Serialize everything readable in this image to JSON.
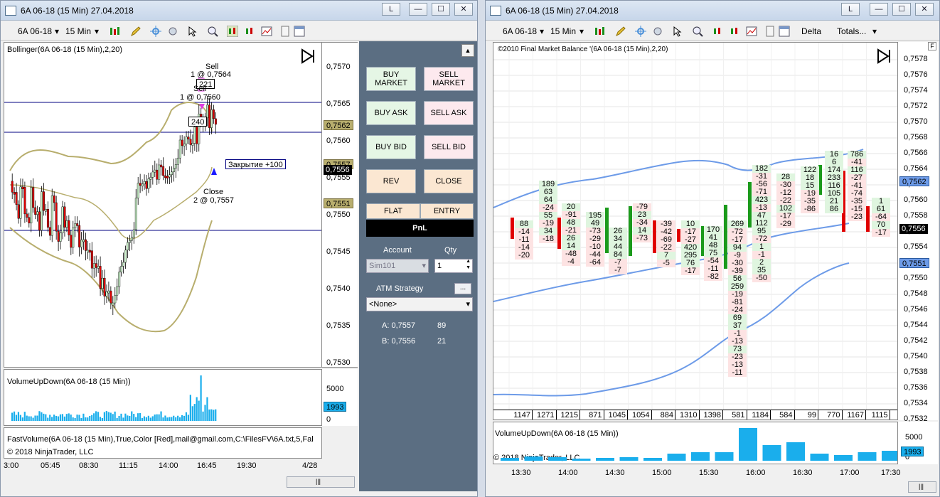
{
  "left_window": {
    "title": "6A 06-18 (15 Min)  27.04.2018",
    "toolbar": {
      "instrument": "6A 06-18",
      "timeframe": "15 Min"
    },
    "buttons": {
      "l": "L",
      "min": "—",
      "max": "☐",
      "close": "✕"
    },
    "indicator_top": "Bollinger(6A 06-18 (15 Min),2,20)",
    "indicator_vol": "VolumeUpDown(6A 06-18 (15 Min))",
    "fastvolume": "FastVolume(6A 06-18 (15 Min),True,Color [Red],mail@gmail.com,C:\\FilesFV\\6A.txt,5,Fal",
    "copyright": "© 2018 NinjaTrader, LLC",
    "price_axis": [
      "0,7570",
      "0,7565",
      "0,7560",
      "0,7555",
      "0,7550",
      "0,7545",
      "0,7540",
      "0,7535",
      "0,7530"
    ],
    "price_badges": {
      "b1": "0,7562",
      "b2": "0,7557",
      "b3": "0,7556",
      "b4": "0,7551"
    },
    "vol_axis": [
      "5000",
      "0"
    ],
    "vol_badge": "1993",
    "time_axis": [
      "3:00",
      "05:45",
      "08:30",
      "11:15",
      "14:00",
      "16:45",
      "19:30",
      "4/28"
    ],
    "annotations": {
      "sell1": "Sell",
      "sell1b": "1 @ 0,7564",
      "sell2": "Sell",
      "sell2b": "1 @ 0,7560",
      "q221": "221",
      "q240": "240",
      "close": "Close",
      "closeb": "2 @ 0,7557",
      "closing": "Закрытие +100"
    }
  },
  "order_panel": {
    "buy_market": "BUY MARKET",
    "sell_market": "SELL MARKET",
    "buy_ask": "BUY ASK",
    "sell_ask": "SELL ASK",
    "buy_bid": "BUY BID",
    "sell_bid": "SELL BID",
    "rev": "REV",
    "close": "CLOSE",
    "flat": "FLAT",
    "entry": "ENTRY",
    "pnl": "PnL",
    "account_label": "Account",
    "qty_label": "Qty",
    "account_value": "Sim101",
    "qty_value": "1",
    "atm_label": "ATM Strategy",
    "atm_btn": "...",
    "atm_value": "<None>",
    "ask_label": "A: 0,7557",
    "ask_size": "89",
    "bid_label": "B: 0,7556",
    "bid_size": "21"
  },
  "right_window": {
    "title": "6A 06-18 (15 Min)  27.04.2018",
    "toolbar": {
      "instrument": "6A 06-18",
      "timeframe": "15 Min",
      "delta": "Delta",
      "totals": "Totals..."
    },
    "buttons": {
      "l": "L",
      "min": "—",
      "max": "☐",
      "close": "✕"
    },
    "indicator_top": "©2010 Final Market Balance  '(6A 06-18 (15 Min),2,20)",
    "indicator_vol": "VolumeUpDown(6A 06-18 (15 Min))",
    "copyright": "© 2018 NinjaTrader, LLC",
    "f_label": "F",
    "price_axis": [
      "0,7578",
      "0,7576",
      "0,7574",
      "0,7572",
      "0,7570",
      "0,7568",
      "0,7566",
      "0,7564",
      "0,7562",
      "0,7560",
      "0,7558",
      "0,7556",
      "0,7554",
      "0,7552",
      "0,7550",
      "0,7548",
      "0,7546",
      "0,7544",
      "0,7542",
      "0,7540",
      "0,7538",
      "0,7536",
      "0,7534",
      "0,7532"
    ],
    "price_badges": {
      "b1": "0,7562",
      "b2": "0,7556",
      "b3": "0,7551"
    },
    "vol_axis": [
      "5000",
      "0"
    ],
    "vol_badge": "1993",
    "time_axis": [
      "13:30",
      "14:00",
      "14:30",
      "15:00",
      "15:30",
      "16:00",
      "16:30",
      "17:00",
      "17:30"
    ],
    "totals_row": [
      "1147",
      "1271",
      "1215",
      "871",
      "1045",
      "1054",
      "884",
      "1310",
      "1398",
      "581",
      "1184",
      "584",
      "99",
      "770",
      "1167",
      "1115"
    ]
  },
  "colors": {
    "bull": "#00aa00",
    "bear": "#dd0000",
    "band": "#b8ae6e",
    "blue_band": "#6d9be8",
    "vol": "#1aaeec"
  }
}
